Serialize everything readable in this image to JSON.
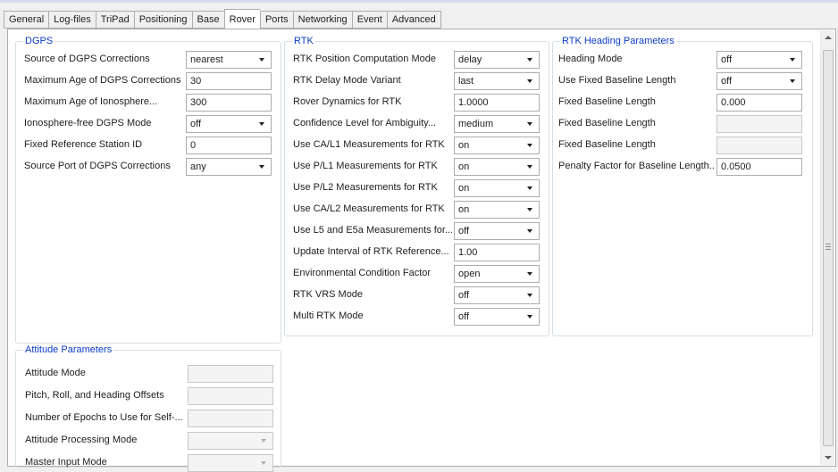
{
  "tabs": [
    "General",
    "Log-files",
    "TriPad",
    "Positioning",
    "Base",
    "Rover",
    "Ports",
    "Networking",
    "Event",
    "Advanced"
  ],
  "active_tab": "Rover",
  "dgps": {
    "title": "DGPS",
    "rows": [
      {
        "label": "Source of DGPS Corrections",
        "value": "nearest",
        "type": "select"
      },
      {
        "label": "Maximum Age of DGPS Corrections",
        "value": "30",
        "type": "text"
      },
      {
        "label": "Maximum Age of Ionosphere...",
        "value": "300",
        "type": "text"
      },
      {
        "label": "Ionosphere-free DGPS Mode",
        "value": "off",
        "type": "select"
      },
      {
        "label": "Fixed Reference Station ID",
        "value": "0",
        "type": "text"
      },
      {
        "label": "Source Port of DGPS Corrections",
        "value": "any",
        "type": "select"
      }
    ]
  },
  "rtk": {
    "title": "RTK",
    "rows": [
      {
        "label": "RTK Position Computation Mode",
        "value": "delay",
        "type": "select"
      },
      {
        "label": "RTK Delay Mode Variant",
        "value": "last",
        "type": "select"
      },
      {
        "label": "Rover Dynamics for RTK",
        "value": "1.0000",
        "type": "text"
      },
      {
        "label": "Confidence Level for Ambiguity...",
        "value": "medium",
        "type": "select"
      },
      {
        "label": "Use CA/L1 Measurements for RTK",
        "value": "on",
        "type": "select"
      },
      {
        "label": "Use P/L1 Measurements for RTK",
        "value": "on",
        "type": "select"
      },
      {
        "label": "Use P/L2 Measurements for RTK",
        "value": "on",
        "type": "select"
      },
      {
        "label": "Use CA/L2 Measurements for RTK",
        "value": "on",
        "type": "select"
      },
      {
        "label": "Use L5 and E5a Measurements for...",
        "value": "off",
        "type": "select"
      },
      {
        "label": "Update Interval of RTK Reference...",
        "value": "1.00",
        "type": "text"
      },
      {
        "label": "Environmental Condition Factor",
        "value": "open",
        "type": "select"
      },
      {
        "label": "RTK VRS Mode",
        "value": "off",
        "type": "select"
      },
      {
        "label": "Multi RTK Mode",
        "value": "off",
        "type": "select"
      }
    ]
  },
  "heading": {
    "title": "RTK Heading Parameters",
    "rows": [
      {
        "label": "Heading Mode",
        "value": "off",
        "type": "select"
      },
      {
        "label": "Use Fixed Baseline Length",
        "value": "off",
        "type": "select"
      },
      {
        "label": "Fixed Baseline Length",
        "value": "0.000",
        "type": "text"
      },
      {
        "label": "Fixed Baseline Length",
        "value": "",
        "type": "disabled"
      },
      {
        "label": "Fixed Baseline Length",
        "value": "",
        "type": "disabled"
      },
      {
        "label": "Penalty Factor for Baseline Length...",
        "value": "0.0500",
        "type": "text"
      }
    ]
  },
  "attitude": {
    "title": "Attitude Parameters",
    "rows": [
      {
        "label": "Attitude Mode",
        "value": "",
        "type": "disabled"
      },
      {
        "label": "Pitch, Roll, and Heading Offsets",
        "value": "",
        "type": "disabled"
      },
      {
        "label": "Number of Epochs to Use for Self-...",
        "value": "",
        "type": "disabled"
      },
      {
        "label": "Attitude Processing Mode",
        "value": "",
        "type": "disabled-select"
      },
      {
        "label": "Master Input Mode",
        "value": "",
        "type": "disabled-select"
      }
    ]
  }
}
